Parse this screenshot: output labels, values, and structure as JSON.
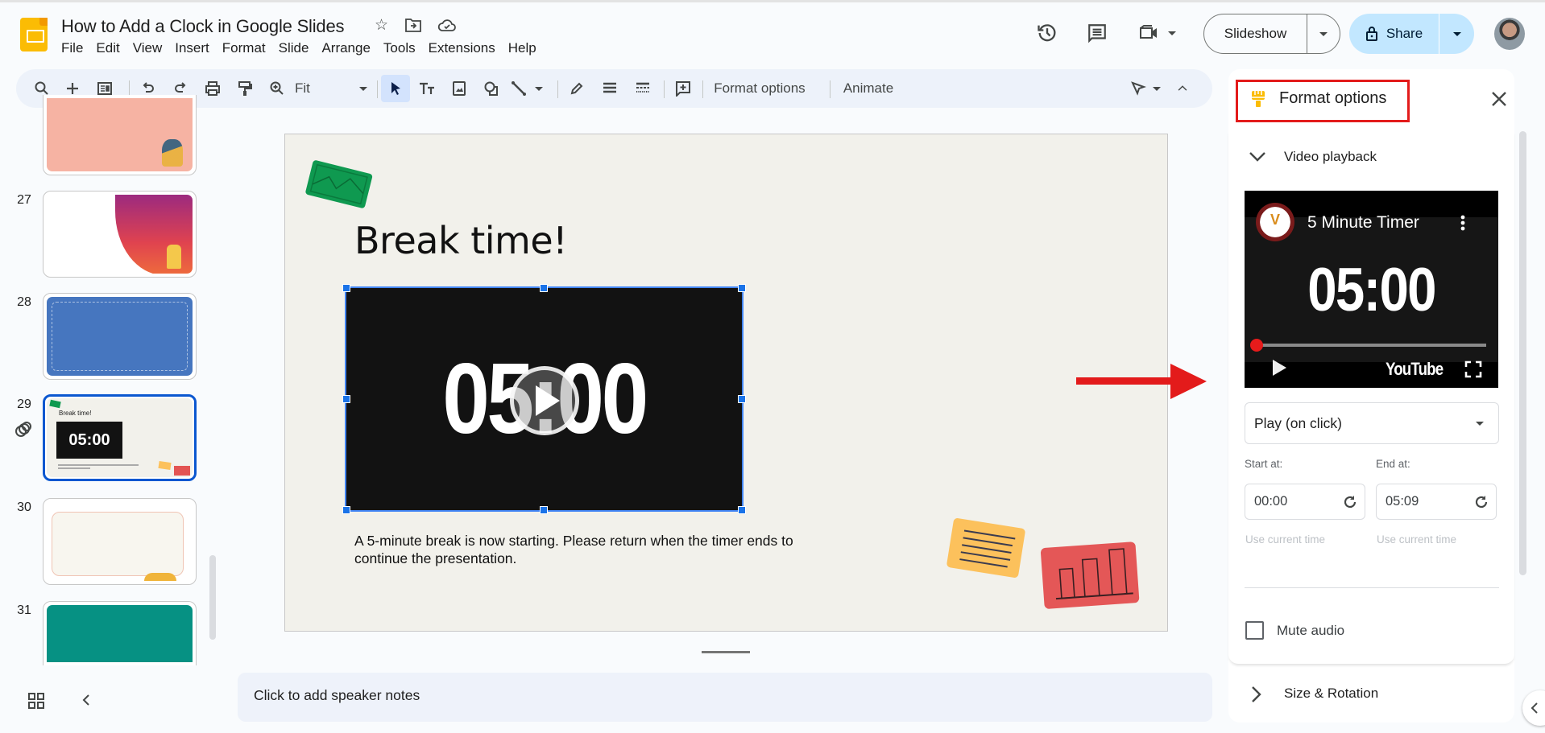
{
  "app": {
    "title": "How to Add a Clock in Google Slides",
    "menu": [
      "File",
      "Edit",
      "View",
      "Insert",
      "Format",
      "Slide",
      "Arrange",
      "Tools",
      "Extensions",
      "Help"
    ],
    "slideshow_label": "Slideshow",
    "share_label": "Share"
  },
  "toolbar": {
    "zoom_value": "Fit",
    "format_options_label": "Format options",
    "animate_label": "Animate"
  },
  "filmstrip": {
    "slides": [
      {
        "number": "",
        "theme": "salmon"
      },
      {
        "number": "27",
        "theme": "gradient"
      },
      {
        "number": "28",
        "theme": "blue"
      },
      {
        "number": "29",
        "theme": "break",
        "selected": true,
        "thumb_title": "Break time!",
        "thumb_timer": "05:00"
      },
      {
        "number": "30",
        "theme": "phone"
      },
      {
        "number": "31",
        "theme": "teal"
      }
    ]
  },
  "slide": {
    "title": "Break time!",
    "video_time": "05:00",
    "body": "A 5-minute break is now starting. Please return when the timer ends to continue the presentation."
  },
  "notes": {
    "placeholder": "Click to add speaker notes"
  },
  "panel": {
    "title": "Format options",
    "section_video": "Video playback",
    "video": {
      "title": "5 Minute Timer",
      "time": "05:00",
      "brand": "YouTube",
      "progress": 0
    },
    "play_mode": "Play (on click)",
    "start_label": "Start at:",
    "end_label": "End at:",
    "start_value": "00:00",
    "end_value": "05:09",
    "use_current_time": "Use current time",
    "mute_label": "Mute audio",
    "mute_checked": false,
    "section_size": "Size & Rotation"
  },
  "colors": {
    "accent": "#0b57d0",
    "share_bg": "#c2e7ff",
    "annotation_red": "#e31b1b",
    "slides_yellow": "#fbbc04"
  }
}
